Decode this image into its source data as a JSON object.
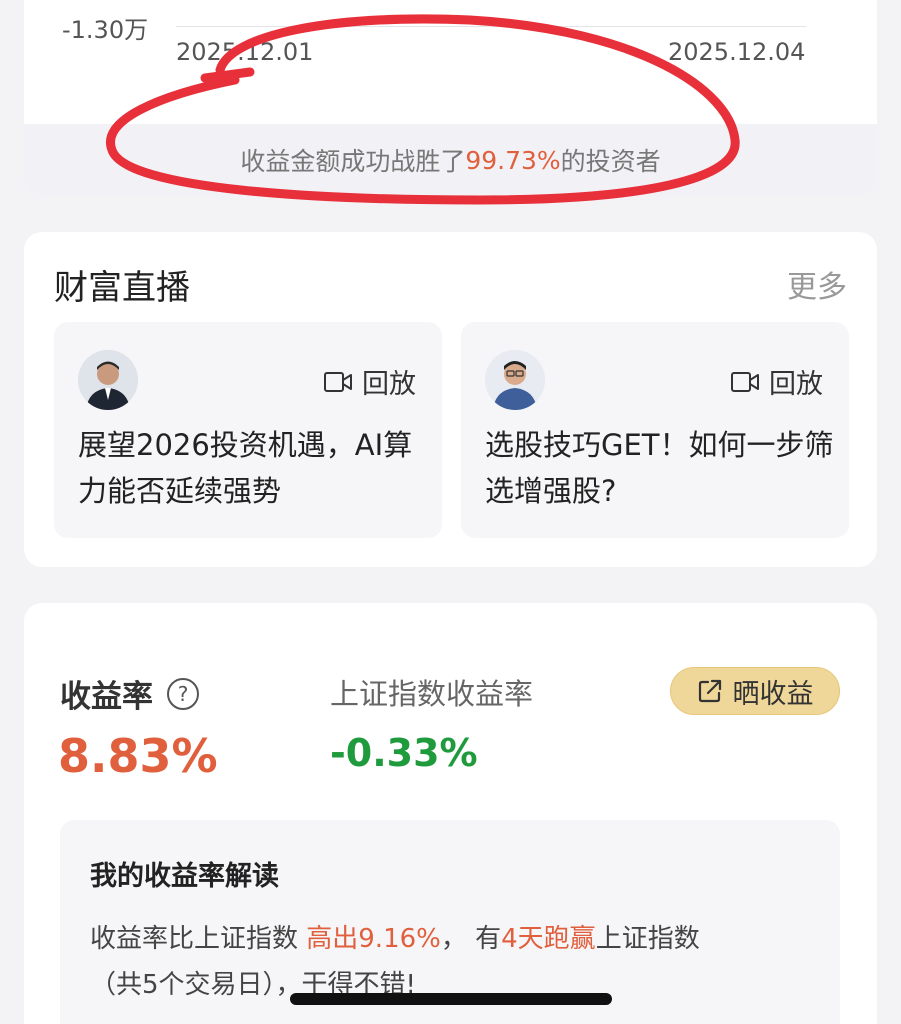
{
  "chart_tail": {
    "y_label": "-1.30万",
    "x_start": "2025.12.01",
    "x_end": "2025.12.04"
  },
  "beat": {
    "prefix": "收益金额成功战胜了",
    "percent": "99.73%",
    "suffix": "的投资者"
  },
  "live": {
    "title": "财富直播",
    "more": "更多",
    "items": [
      {
        "replay_label": "回放",
        "text": "展望2026投资机遇，AI算力能否延续强势",
        "icon": "video-camera-icon"
      },
      {
        "replay_label": "回放",
        "text": "选股技巧GET！如何一步筛选增强股?",
        "icon": "video-camera-icon"
      }
    ]
  },
  "rate": {
    "label": "收益率",
    "value": "8.83%",
    "index_label": "上证指数收益率",
    "index_value": "-0.33%",
    "share_label": "晒收益"
  },
  "interpretation": {
    "title": "我的收益率解读",
    "t1": "收益率比上证指数 ",
    "t2": "高出9.16%",
    "t3": "， 有",
    "t4": "4天跑赢",
    "t5": "上证指数",
    "t6": "（共5个交易日），干得不错!"
  },
  "colors": {
    "accent_red": "#e0603e",
    "accent_green": "#1f9a3c",
    "share_bg": "#efd79a",
    "annotation": "#e8303a"
  }
}
